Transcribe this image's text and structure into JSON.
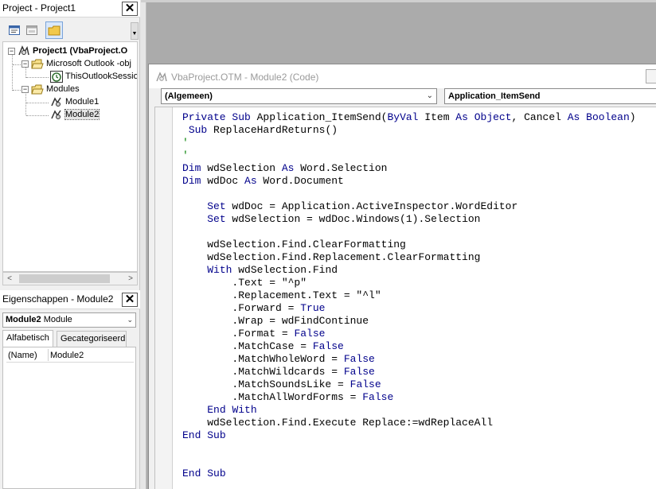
{
  "project_panel": {
    "title": "Project - Project1",
    "close_glyph": "✕",
    "toolbar": [
      "view-code-icon",
      "view-object-icon",
      "toggle-folders-icon"
    ],
    "tree": [
      {
        "label": "Project1 (VbaProject.O",
        "icon": "vba-project-icon",
        "expander": "−",
        "bold": true
      },
      {
        "label": "Microsoft Outlook -obj",
        "icon": "folder-open-icon",
        "expander": "−"
      },
      {
        "label": "ThisOutlookSession",
        "icon": "outlook-session-icon"
      },
      {
        "label": "Modules",
        "icon": "folder-open-icon",
        "expander": "−"
      },
      {
        "label": "Module1",
        "icon": "module-icon"
      },
      {
        "label": "Module2",
        "icon": "module-icon",
        "selected": true
      }
    ]
  },
  "properties_panel": {
    "title": "Eigenschappen - Module2",
    "close_glyph": "✕",
    "object_name": "Module2",
    "object_type": "Module",
    "tabs": [
      "Alfabetisch",
      "Gecategoriseerd"
    ],
    "rows": [
      {
        "name": "(Name)",
        "value": "Module2"
      }
    ]
  },
  "code_window": {
    "title": "VbaProject.OTM - Module2 (Code)",
    "object_combo": "(Algemeen)",
    "procedure_combo": "Application_ItemSend"
  },
  "colors": {
    "keyword": "#00008b",
    "comment": "#008000"
  }
}
